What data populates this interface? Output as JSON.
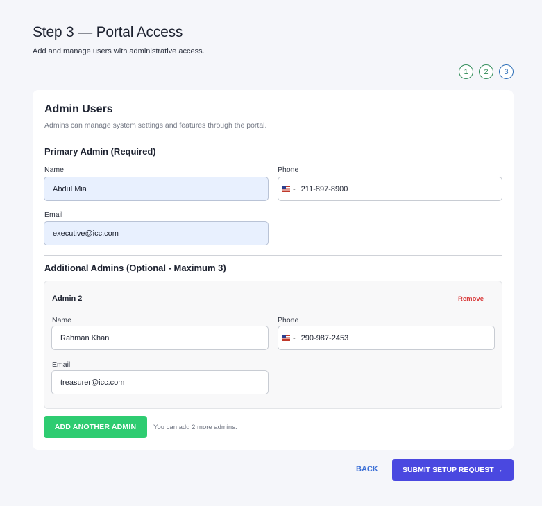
{
  "header": {
    "title": "Step 3 — Portal Access",
    "subtitle": "Add and manage users with administrative access."
  },
  "steps": [
    "1",
    "2",
    "3"
  ],
  "card": {
    "title": "Admin Users",
    "description": "Admins can manage system settings and features through the portal."
  },
  "primary_admin": {
    "section_title": "Primary Admin (Required)",
    "name_label": "Name",
    "name_value": "Abdul Mia",
    "phone_label": "Phone",
    "phone_value": "211-897-8900",
    "email_label": "Email",
    "email_value": "executive@icc.com"
  },
  "additional_admins": {
    "section_title": "Additional Admins (Optional - Maximum 3)",
    "admins": [
      {
        "title": "Admin 2",
        "remove_label": "Remove",
        "name_label": "Name",
        "name_value": "Rahman Khan",
        "phone_label": "Phone",
        "phone_value": "290-987-2453",
        "email_label": "Email",
        "email_value": "treasurer@icc.com"
      }
    ],
    "add_button_label": "ADD ANOTHER ADMIN",
    "add_hint": "You can add 2 more admins."
  },
  "footer": {
    "back_label": "BACK",
    "submit_label": "SUBMIT SETUP REQUEST →"
  },
  "icons": {
    "flag": "us-flag-icon"
  },
  "colors": {
    "accent_green": "#2ecc71",
    "submit_purple": "#4a48e0",
    "remove_red": "#d93a3a",
    "link_blue": "#3b6fd6"
  }
}
